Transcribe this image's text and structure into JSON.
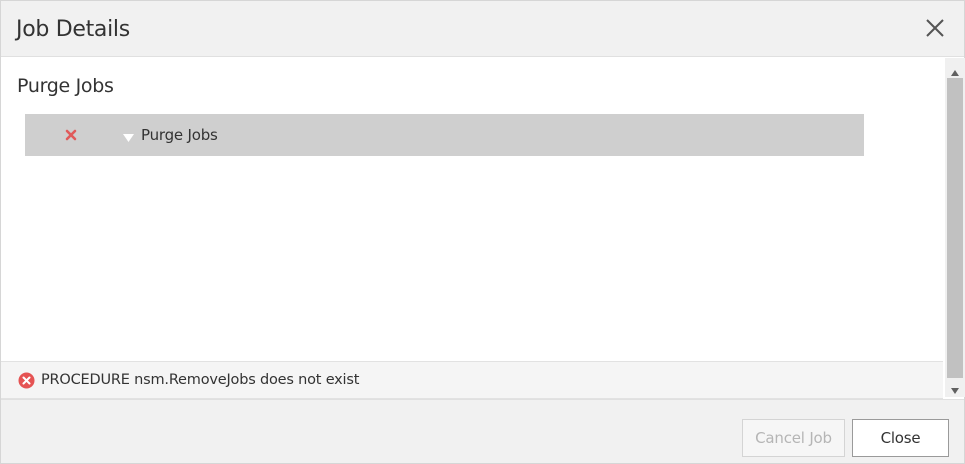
{
  "dialog": {
    "title": "Job Details",
    "close_icon": "close-icon"
  },
  "main": {
    "section_title": "Purge Jobs",
    "job_row": {
      "status_icon": "error-x-icon",
      "status_color": "#e05a5a",
      "expand_icon": "triangle-down-icon",
      "label": "Purge Jobs"
    }
  },
  "error": {
    "icon": "error-circle-icon",
    "icon_color": "#e55353",
    "message": "PROCEDURE nsm.RemoveJobs does not exist"
  },
  "footer": {
    "cancel_label": "Cancel Job",
    "close_label": "Close"
  }
}
